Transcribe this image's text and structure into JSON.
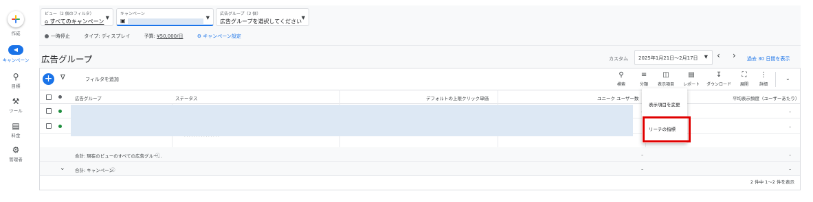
{
  "rail": {
    "create": "作成",
    "campaigns": "キャンペーン",
    "goals": "目標",
    "tools": "ツール",
    "billing": "料金",
    "admin": "管理者"
  },
  "selectors": {
    "view": {
      "label": "ビュー（2 個のフィルタ）",
      "value": "すべてのキャンペーン"
    },
    "campaign": {
      "label": "キャンペーン"
    },
    "ad_group": {
      "label": "広告グループ（2 個）",
      "value": "広告グループを選択してください"
    }
  },
  "info": {
    "status": "一時停止",
    "type": "タイプ: ディスプレイ",
    "budget_label": "予算:",
    "budget_value": "¥50,000/日",
    "settings_link": "キャンペーン設定"
  },
  "header": {
    "title": "広告グループ",
    "custom": "カスタム",
    "date_range": "2025年1月21日～2月17日",
    "last30": "過去 30 日間を表示"
  },
  "toolbar": {
    "filter_add": "フィルタを追加",
    "search": "検索",
    "segment": "分類",
    "columns": "表示項目",
    "reports": "レポート",
    "download": "ダウンロード",
    "expand": "展開",
    "more": "詳細"
  },
  "table": {
    "columns": {
      "ad_group": "広告グループ",
      "status": "ステータス",
      "default_max_cpc": "デフォルトの上限クリック単価",
      "unique_users": "ユニーク ユーザー数",
      "avg_frequency": "平均表示頻度（ユーザーあたり）"
    },
    "dash": "–",
    "total_view": "合計: 現在のビューのすべての広告グルー...",
    "total_campaign": "合計: キャンペーン"
  },
  "menu": {
    "modify_columns": "表示項目を変更",
    "reach_metrics": "リーチの指標"
  },
  "pagination": "2 件中 1～2 件を表示",
  "colors": {
    "accent": "#1a73e8",
    "enabled": "#1e8e3e",
    "highlight": "#e00000"
  }
}
